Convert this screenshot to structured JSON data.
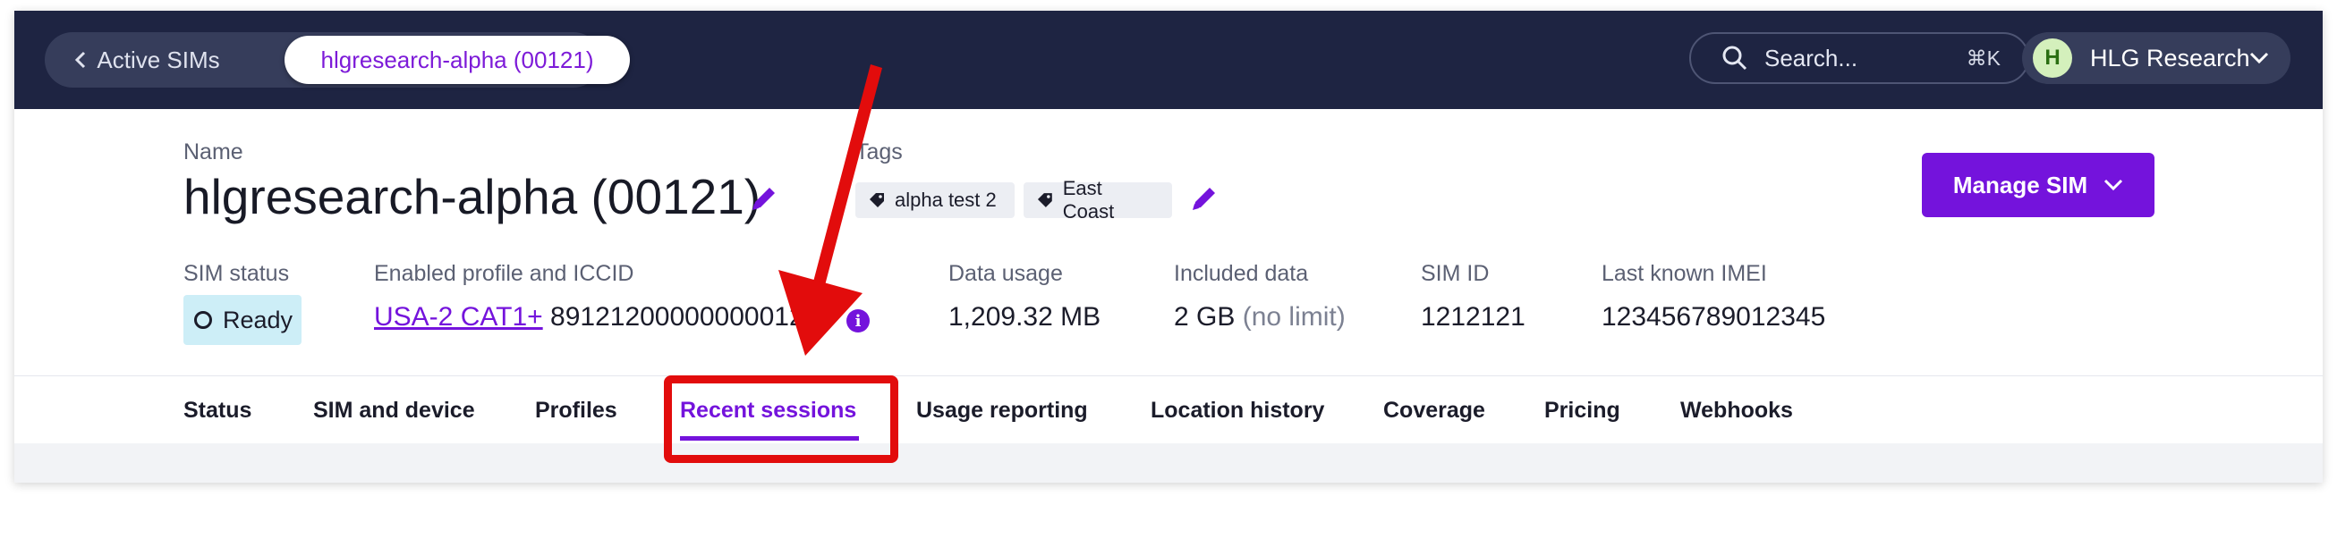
{
  "topbar": {
    "back_label": "Active SIMs",
    "current_crumb": "hlgresearch-alpha (00121)",
    "search_placeholder": "Search...",
    "search_shortcut": "⌘K",
    "account_initial": "H",
    "account_name": "HLG Research"
  },
  "header": {
    "name_label": "Name",
    "sim_name": "hlgresearch-alpha (00121)",
    "tags_label": "Tags",
    "tags": [
      "alpha test 2",
      "East Coast"
    ],
    "manage_button": "Manage SIM"
  },
  "details": {
    "status_label": "SIM status",
    "status_value": "Ready",
    "profile_label": "Enabled profile and ICCID",
    "profile_link": "USA-2 CAT1+",
    "iccid": "891212000000000121",
    "data_usage_label": "Data usage",
    "data_usage_value": "1,209.32 MB",
    "included_label": "Included data",
    "included_value": "2 GB",
    "included_note": "(no limit)",
    "sim_id_label": "SIM ID",
    "sim_id_value": "1212121",
    "imei_label": "Last known IMEI",
    "imei_value": "123456789012345"
  },
  "tabs": [
    {
      "label": "Status"
    },
    {
      "label": "SIM and device"
    },
    {
      "label": "Profiles"
    },
    {
      "label": "Recent sessions",
      "active": true
    },
    {
      "label": "Usage reporting"
    },
    {
      "label": "Location history"
    },
    {
      "label": "Coverage"
    },
    {
      "label": "Pricing"
    },
    {
      "label": "Webhooks"
    }
  ],
  "colors": {
    "nav_bg": "#1e2442",
    "accent": "#7413dc",
    "annotation": "#e20c0c",
    "status_badge_bg": "#cdeef7"
  },
  "icons": [
    "chevron-left-icon",
    "search-icon",
    "chevron-down-icon",
    "pencil-icon",
    "tag-icon",
    "info-icon"
  ]
}
